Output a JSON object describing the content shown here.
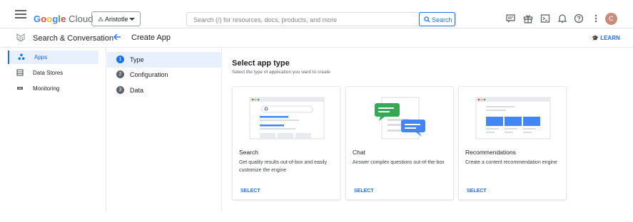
{
  "header": {
    "logo_google": "Google",
    "logo_cloud": "Cloud",
    "project": "Aristotle",
    "search_placeholder": "Search (/) for resources, docs, products, and more",
    "search_button": "Search",
    "avatar_initial": "C"
  },
  "subheader": {
    "product": "Search & Conversation",
    "page_title": "Create App",
    "learn": "LEARN"
  },
  "sidebar": {
    "items": [
      {
        "label": "Apps"
      },
      {
        "label": "Data Stores"
      },
      {
        "label": "Monitoring"
      }
    ]
  },
  "steps": [
    {
      "num": "1",
      "label": "Type"
    },
    {
      "num": "2",
      "label": "Configuration"
    },
    {
      "num": "3",
      "label": "Data"
    }
  ],
  "main": {
    "title": "Select app type",
    "subtitle": "Select the type of application you want to create",
    "cards": [
      {
        "title": "Search",
        "desc": "Get quality results out-of-box and easily customize the engine",
        "select": "SELECT"
      },
      {
        "title": "Chat",
        "desc": "Answer complex questions out-of-the-box",
        "select": "SELECT"
      },
      {
        "title": "Recommendations",
        "desc": "Create a content recommendation engine",
        "select": "SELECT"
      }
    ]
  },
  "colors": {
    "accent": "#1a73e8",
    "active_bg": "#e8f0fe",
    "chat_green": "#34a853"
  }
}
